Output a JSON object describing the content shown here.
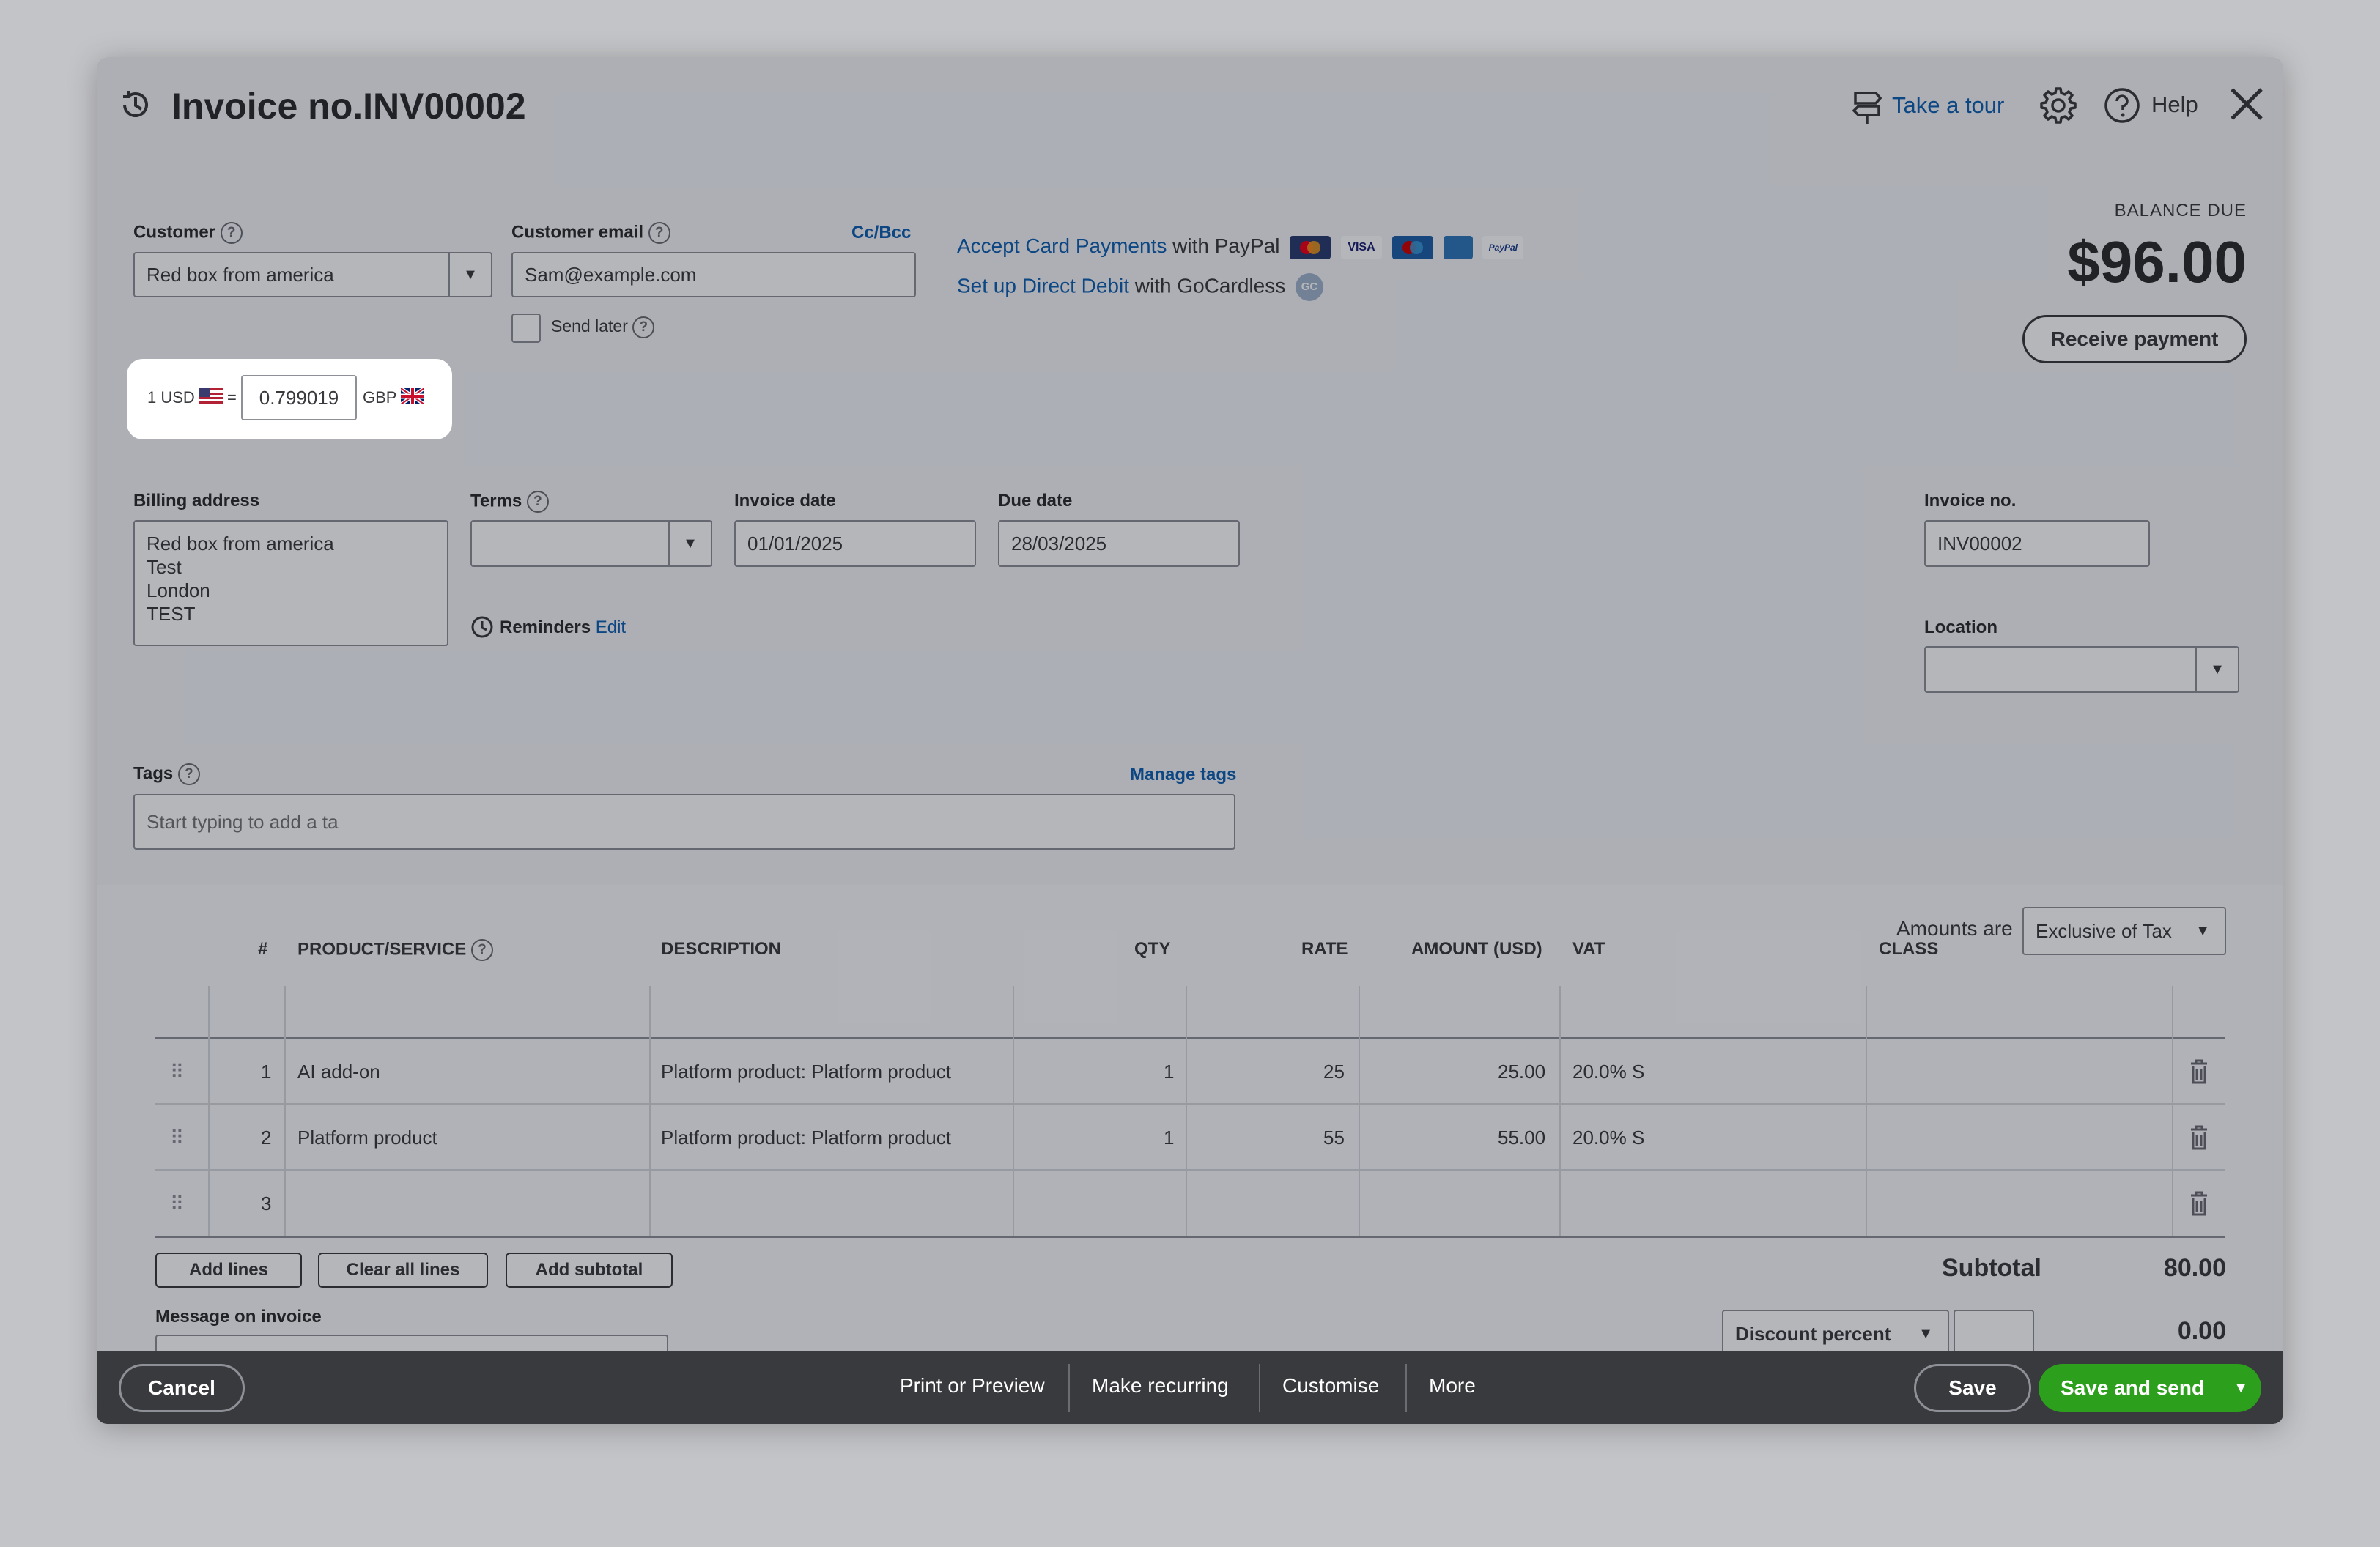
{
  "header": {
    "title": "Invoice no.INV00002",
    "take_tour": "Take a tour",
    "help": "Help"
  },
  "customer": {
    "label": "Customer",
    "value": "Red box from america"
  },
  "email": {
    "label": "Customer email",
    "ccbcc": "Cc/Bcc",
    "value": "Sam@example.com",
    "send_later": "Send later"
  },
  "payments": {
    "card_link": "Accept Card Payments",
    "card_suffix": "with PayPal",
    "debit_link": "Set up Direct Debit",
    "debit_suffix": "with GoCardless",
    "gc_badge": "GC",
    "card_logos": [
      "mastercard-logo",
      "visa-logo",
      "maestro-logo",
      "amex-logo",
      "paypal-logo"
    ],
    "visa_text": "VISA",
    "paypal_text": "PayPal"
  },
  "balance": {
    "label": "BALANCE DUE",
    "amount": "$96.00",
    "receive_payment": "Receive payment"
  },
  "exchange": {
    "from": "1 USD",
    "equals": "=",
    "rate": "0.799019",
    "to": "GBP"
  },
  "billing": {
    "label": "Billing address",
    "lines": [
      "Red box from america",
      "Test",
      "London",
      "TEST"
    ]
  },
  "terms": {
    "label": "Terms",
    "value": ""
  },
  "invoice_date": {
    "label": "Invoice date",
    "value": "01/01/2025"
  },
  "due_date": {
    "label": "Due date",
    "value": "28/03/2025"
  },
  "reminders": {
    "label": "Reminders",
    "edit": "Edit"
  },
  "invoice_no": {
    "label": "Invoice no.",
    "value": "INV00002"
  },
  "location": {
    "label": "Location",
    "value": ""
  },
  "tags": {
    "label": "Tags",
    "manage": "Manage tags",
    "placeholder": "Start typing to add a ta"
  },
  "amounts": {
    "label": "Amounts are",
    "value": "Exclusive of Tax"
  },
  "table": {
    "headers": {
      "num": "#",
      "product": "PRODUCT/SERVICE",
      "description": "DESCRIPTION",
      "qty": "QTY",
      "rate": "RATE",
      "amount": "AMOUNT (USD)",
      "vat": "VAT",
      "class": "CLASS"
    },
    "rows": [
      {
        "num": "1",
        "product": "AI add-on",
        "description": "Platform product: Platform product",
        "qty": "1",
        "rate": "25",
        "amount": "25.00",
        "vat": "20.0% S",
        "class": ""
      },
      {
        "num": "2",
        "product": "Platform product",
        "description": "Platform product: Platform product",
        "qty": "1",
        "rate": "55",
        "amount": "55.00",
        "vat": "20.0% S",
        "class": ""
      },
      {
        "num": "3",
        "product": "",
        "description": "",
        "qty": "",
        "rate": "",
        "amount": "",
        "vat": "",
        "class": ""
      }
    ]
  },
  "actions": {
    "add_lines": "Add lines",
    "clear_all": "Clear all lines",
    "add_subtotal": "Add subtotal"
  },
  "message": {
    "label": "Message on invoice"
  },
  "totals": {
    "subtotal_label": "Subtotal",
    "subtotal": "80.00",
    "discount_type": "Discount percent",
    "discount_amount": "0.00"
  },
  "footer": {
    "cancel": "Cancel",
    "print": "Print or Preview",
    "recurring": "Make recurring",
    "customise": "Customise",
    "more": "More",
    "save": "Save",
    "save_send": "Save and send"
  }
}
